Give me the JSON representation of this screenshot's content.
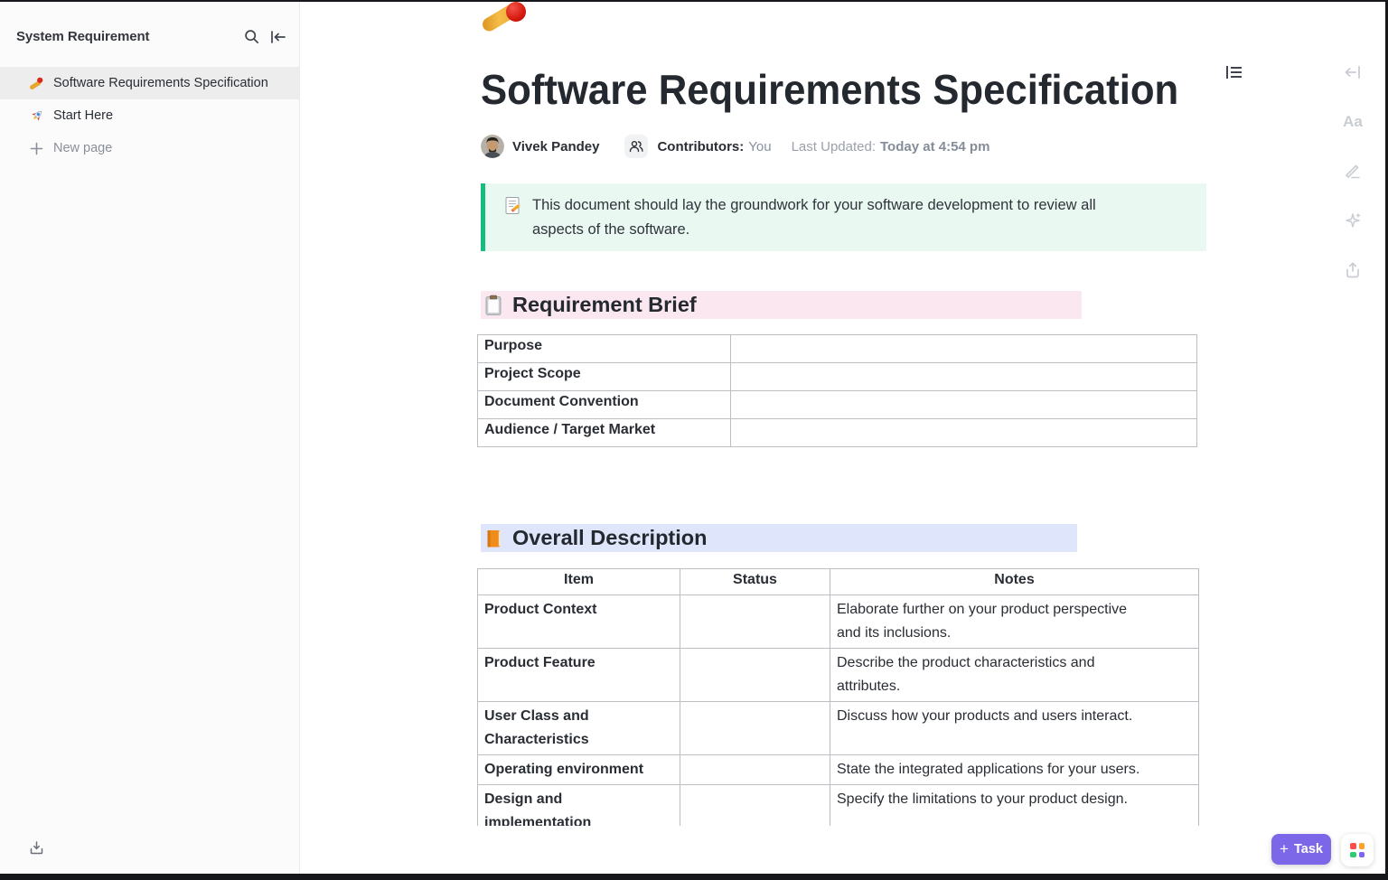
{
  "sidebar": {
    "title": "System Requirement",
    "items": [
      {
        "label": "Software Requirements Specification",
        "icon": "cricket-bat",
        "selected": true
      },
      {
        "label": "Start Here",
        "icon": "rocket",
        "selected": false
      }
    ],
    "new_page_label": "New page"
  },
  "doc": {
    "page_icon": "cricket-bat-and-ball",
    "title": "Software Requirements Specification",
    "author": "Vivek Pandey",
    "contributors_label": "Contributors:",
    "contributors_value": "You",
    "last_updated_label": "Last Updated:",
    "last_updated_value": "Today at 4:54 pm",
    "callout": {
      "icon": "memo",
      "text": "This document should lay the groundwork for your software development to review all aspects of the software.",
      "accent_color": "#13bd7e",
      "bg_color": "#e9f8f1"
    },
    "section1": {
      "icon": "clipboard",
      "title": "Requirement Brief",
      "highlight_color": "#fbe7ef"
    },
    "section2": {
      "icon": "orange-book",
      "title": "Overall Description",
      "highlight_color": "#dfe6fb"
    },
    "brief_table": {
      "rows": [
        {
          "label": "Purpose",
          "value": ""
        },
        {
          "label": "Project Scope",
          "value": ""
        },
        {
          "label": "Document Convention",
          "value": ""
        },
        {
          "label": "Audience / Target Market",
          "value": ""
        }
      ]
    },
    "overview_table": {
      "headers": [
        "Item",
        "Status",
        "Notes"
      ],
      "rows": [
        {
          "item": "Product Context",
          "status": "",
          "notes": "Elaborate further on your product perspective and its inclusions."
        },
        {
          "item": "Product Feature",
          "status": "",
          "notes": "Describe the product characteristics and attributes."
        },
        {
          "item": "User Class and Characteristics",
          "status": "",
          "notes": "Discuss how your products and users interact."
        },
        {
          "item": "Operating environment",
          "status": "",
          "notes": "State the integrated applications for your users."
        },
        {
          "item": "Design and implementation",
          "status": "",
          "notes": "Specify the limitations to your product design."
        }
      ]
    }
  },
  "footer": {
    "task_button": "Task"
  },
  "colors": {
    "brand_purple": "#7c67e8",
    "dot_red": "#fd4e4e",
    "dot_orange": "#ffa12f",
    "dot_green": "#2fcd6f",
    "dot_purple": "#7c68ee"
  }
}
